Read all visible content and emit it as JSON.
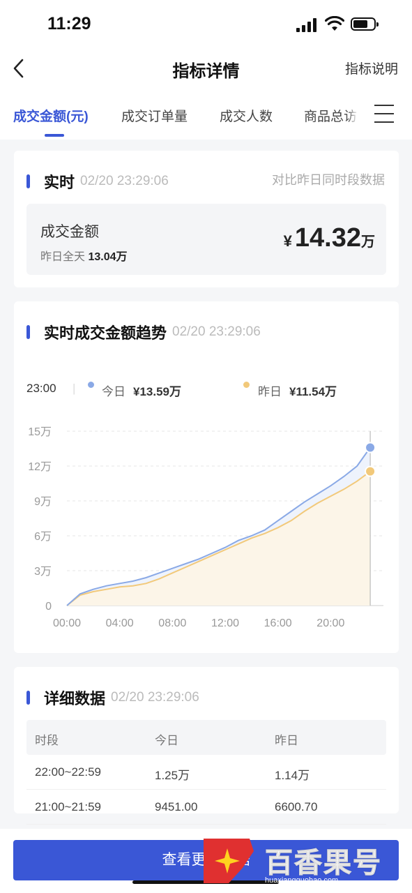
{
  "status": {
    "time": "11:29"
  },
  "nav": {
    "title": "指标详情",
    "right_label": "指标说明"
  },
  "tabs": [
    {
      "label": "成交金额(元)",
      "active": true
    },
    {
      "label": "成交订单量",
      "active": false
    },
    {
      "label": "成交人数",
      "active": false
    },
    {
      "label": "商品总访",
      "active": false
    }
  ],
  "realtime": {
    "title": "实时",
    "time": "02/20 23:29:06",
    "compare_label": "对比昨日同时段数据",
    "metric_label": "成交金额",
    "yesterday_label": "昨日全天",
    "yesterday_value": "13.04万",
    "currency": "¥",
    "value": "14.32",
    "unit": "万"
  },
  "trend": {
    "title": "实时成交金额趋势",
    "time": "02/20 23:29:06",
    "legend_time": "23:00",
    "today_label": "今日",
    "today_value": "¥13.59万",
    "yesterday_label": "昨日",
    "yesterday_value": "¥11.54万"
  },
  "colors": {
    "accent": "#3a57d6",
    "today": "#8aa9e6",
    "yesterday": "#f2c97a"
  },
  "chart_data": {
    "type": "line",
    "x_ticks": [
      "00:00",
      "04:00",
      "08:00",
      "12:00",
      "16:00",
      "20:00"
    ],
    "y_ticks": [
      "0",
      "3万",
      "6万",
      "9万",
      "12万",
      "15万"
    ],
    "ylim": [
      0,
      15
    ],
    "xlim": [
      0,
      24
    ],
    "grid": true,
    "series": [
      {
        "name": "今日",
        "x": [
          0,
          1,
          2,
          3,
          4,
          5,
          6,
          7,
          8,
          9,
          10,
          11,
          12,
          13,
          14,
          15,
          16,
          17,
          18,
          19,
          20,
          21,
          22,
          23
        ],
        "values": [
          0,
          1.0,
          1.4,
          1.7,
          1.9,
          2.1,
          2.4,
          2.8,
          3.2,
          3.6,
          4.0,
          4.5,
          5.0,
          5.6,
          6.0,
          6.5,
          7.3,
          8.1,
          8.9,
          9.6,
          10.3,
          11.1,
          12.0,
          13.59
        ]
      },
      {
        "name": "昨日",
        "x": [
          0,
          1,
          2,
          3,
          4,
          5,
          6,
          7,
          8,
          9,
          10,
          11,
          12,
          13,
          14,
          15,
          16,
          17,
          18,
          19,
          20,
          21,
          22,
          23
        ],
        "values": [
          0,
          0.9,
          1.2,
          1.4,
          1.6,
          1.7,
          1.9,
          2.3,
          2.8,
          3.3,
          3.8,
          4.3,
          4.8,
          5.3,
          5.8,
          6.2,
          6.7,
          7.3,
          8.1,
          8.8,
          9.4,
          10.0,
          10.7,
          11.54
        ]
      }
    ]
  },
  "detail": {
    "title": "详细数据",
    "time": "02/20 23:29:06",
    "headers": [
      "时段",
      "今日",
      "昨日"
    ],
    "rows": [
      [
        "22:00~22:59",
        "1.25万",
        "1.14万"
      ],
      [
        "21:00~21:59",
        "9451.00",
        "6600.70"
      ]
    ]
  },
  "cta": {
    "label": "查看更多数据"
  },
  "watermark": {
    "text": "百香果号",
    "url": "huaxiangguohao.com"
  }
}
